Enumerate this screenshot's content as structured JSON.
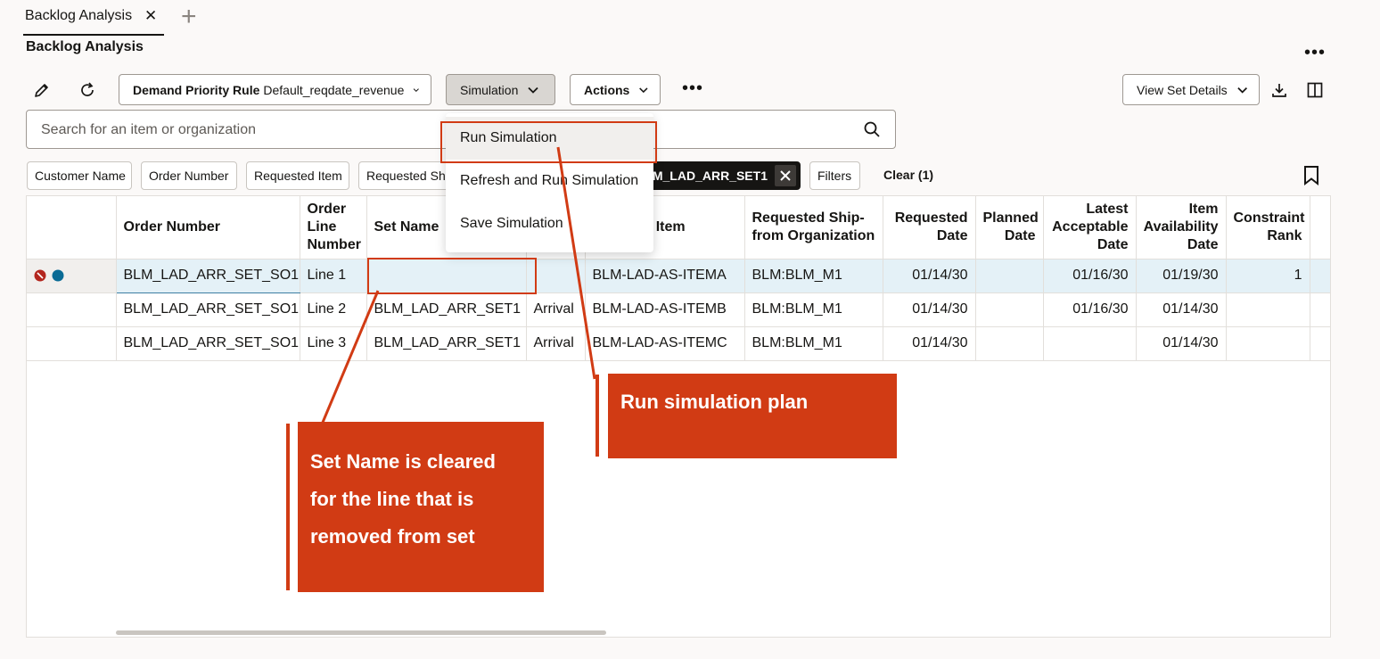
{
  "tab": {
    "label": "Backlog Analysis",
    "close": "✕",
    "add": "+"
  },
  "page": {
    "title": "Backlog Analysis"
  },
  "toolbar": {
    "demand_rule_label": "Demand Priority Rule",
    "demand_rule_value": "Default_reqdate_revenue",
    "simulation_label": "Simulation",
    "actions_label": "Actions",
    "view_set_details_label": "View Set Details"
  },
  "search": {
    "placeholder": "Search for an item or organization"
  },
  "filters": {
    "chips": [
      "Customer Name",
      "Order Number",
      "Requested Item",
      "Requested Shi"
    ],
    "active_chip": "BLM_LAD_ARR_SET1",
    "filters_label": "Filters",
    "clear_label": "Clear (1)"
  },
  "menu": {
    "items": [
      "Run Simulation",
      "Refresh and Run Simulation",
      "Save Simulation"
    ]
  },
  "table": {
    "headers": {
      "order_number": "Order Number",
      "order_line_number": "Order Line Number",
      "set_name": "Set Name",
      "requested_item": "d Item",
      "requested_ship_from": "Requested Ship-from Organization",
      "requested_date": "Requested Date",
      "planned_date": "Planned Date",
      "latest_acceptable_date": "Latest Acceptable Date",
      "item_availability_date": "Item Availability Date",
      "constraint_rank": "Constraint Rank"
    },
    "rows": [
      {
        "order_number": "BLM_LAD_ARR_SET_SO1",
        "line": "Line 1",
        "set_name": "",
        "arrival": "",
        "item": "BLM-LAD-AS-ITEMA",
        "org": "BLM:BLM_M1",
        "req_date": "01/14/30",
        "planned_date": "",
        "latest_date": "01/16/30",
        "avail_date": "01/19/30",
        "rank": "1"
      },
      {
        "order_number": "BLM_LAD_ARR_SET_SO1",
        "line": "Line 2",
        "set_name": "BLM_LAD_ARR_SET1",
        "arrival": "Arrival",
        "item": "BLM-LAD-AS-ITEMB",
        "org": "BLM:BLM_M1",
        "req_date": "01/14/30",
        "planned_date": "",
        "latest_date": "01/16/30",
        "avail_date": "01/14/30",
        "rank": ""
      },
      {
        "order_number": "BLM_LAD_ARR_SET_SO1",
        "line": "Line 3",
        "set_name": "BLM_LAD_ARR_SET1",
        "arrival": "Arrival",
        "item": "BLM-LAD-AS-ITEMC",
        "org": "BLM:BLM_M1",
        "req_date": "01/14/30",
        "planned_date": "",
        "latest_date": "",
        "avail_date": "01/14/30",
        "rank": ""
      }
    ]
  },
  "annotations": {
    "run_plan": "Run simulation plan",
    "set_name_line1": "Set Name is cleared",
    "set_name_line2": "for the line that is",
    "set_name_line3": "removed from set"
  },
  "colors": {
    "callout": "#d13b14",
    "selected_row": "#e4f1f7",
    "error": "#b3261e",
    "info": "#0a6b95"
  }
}
